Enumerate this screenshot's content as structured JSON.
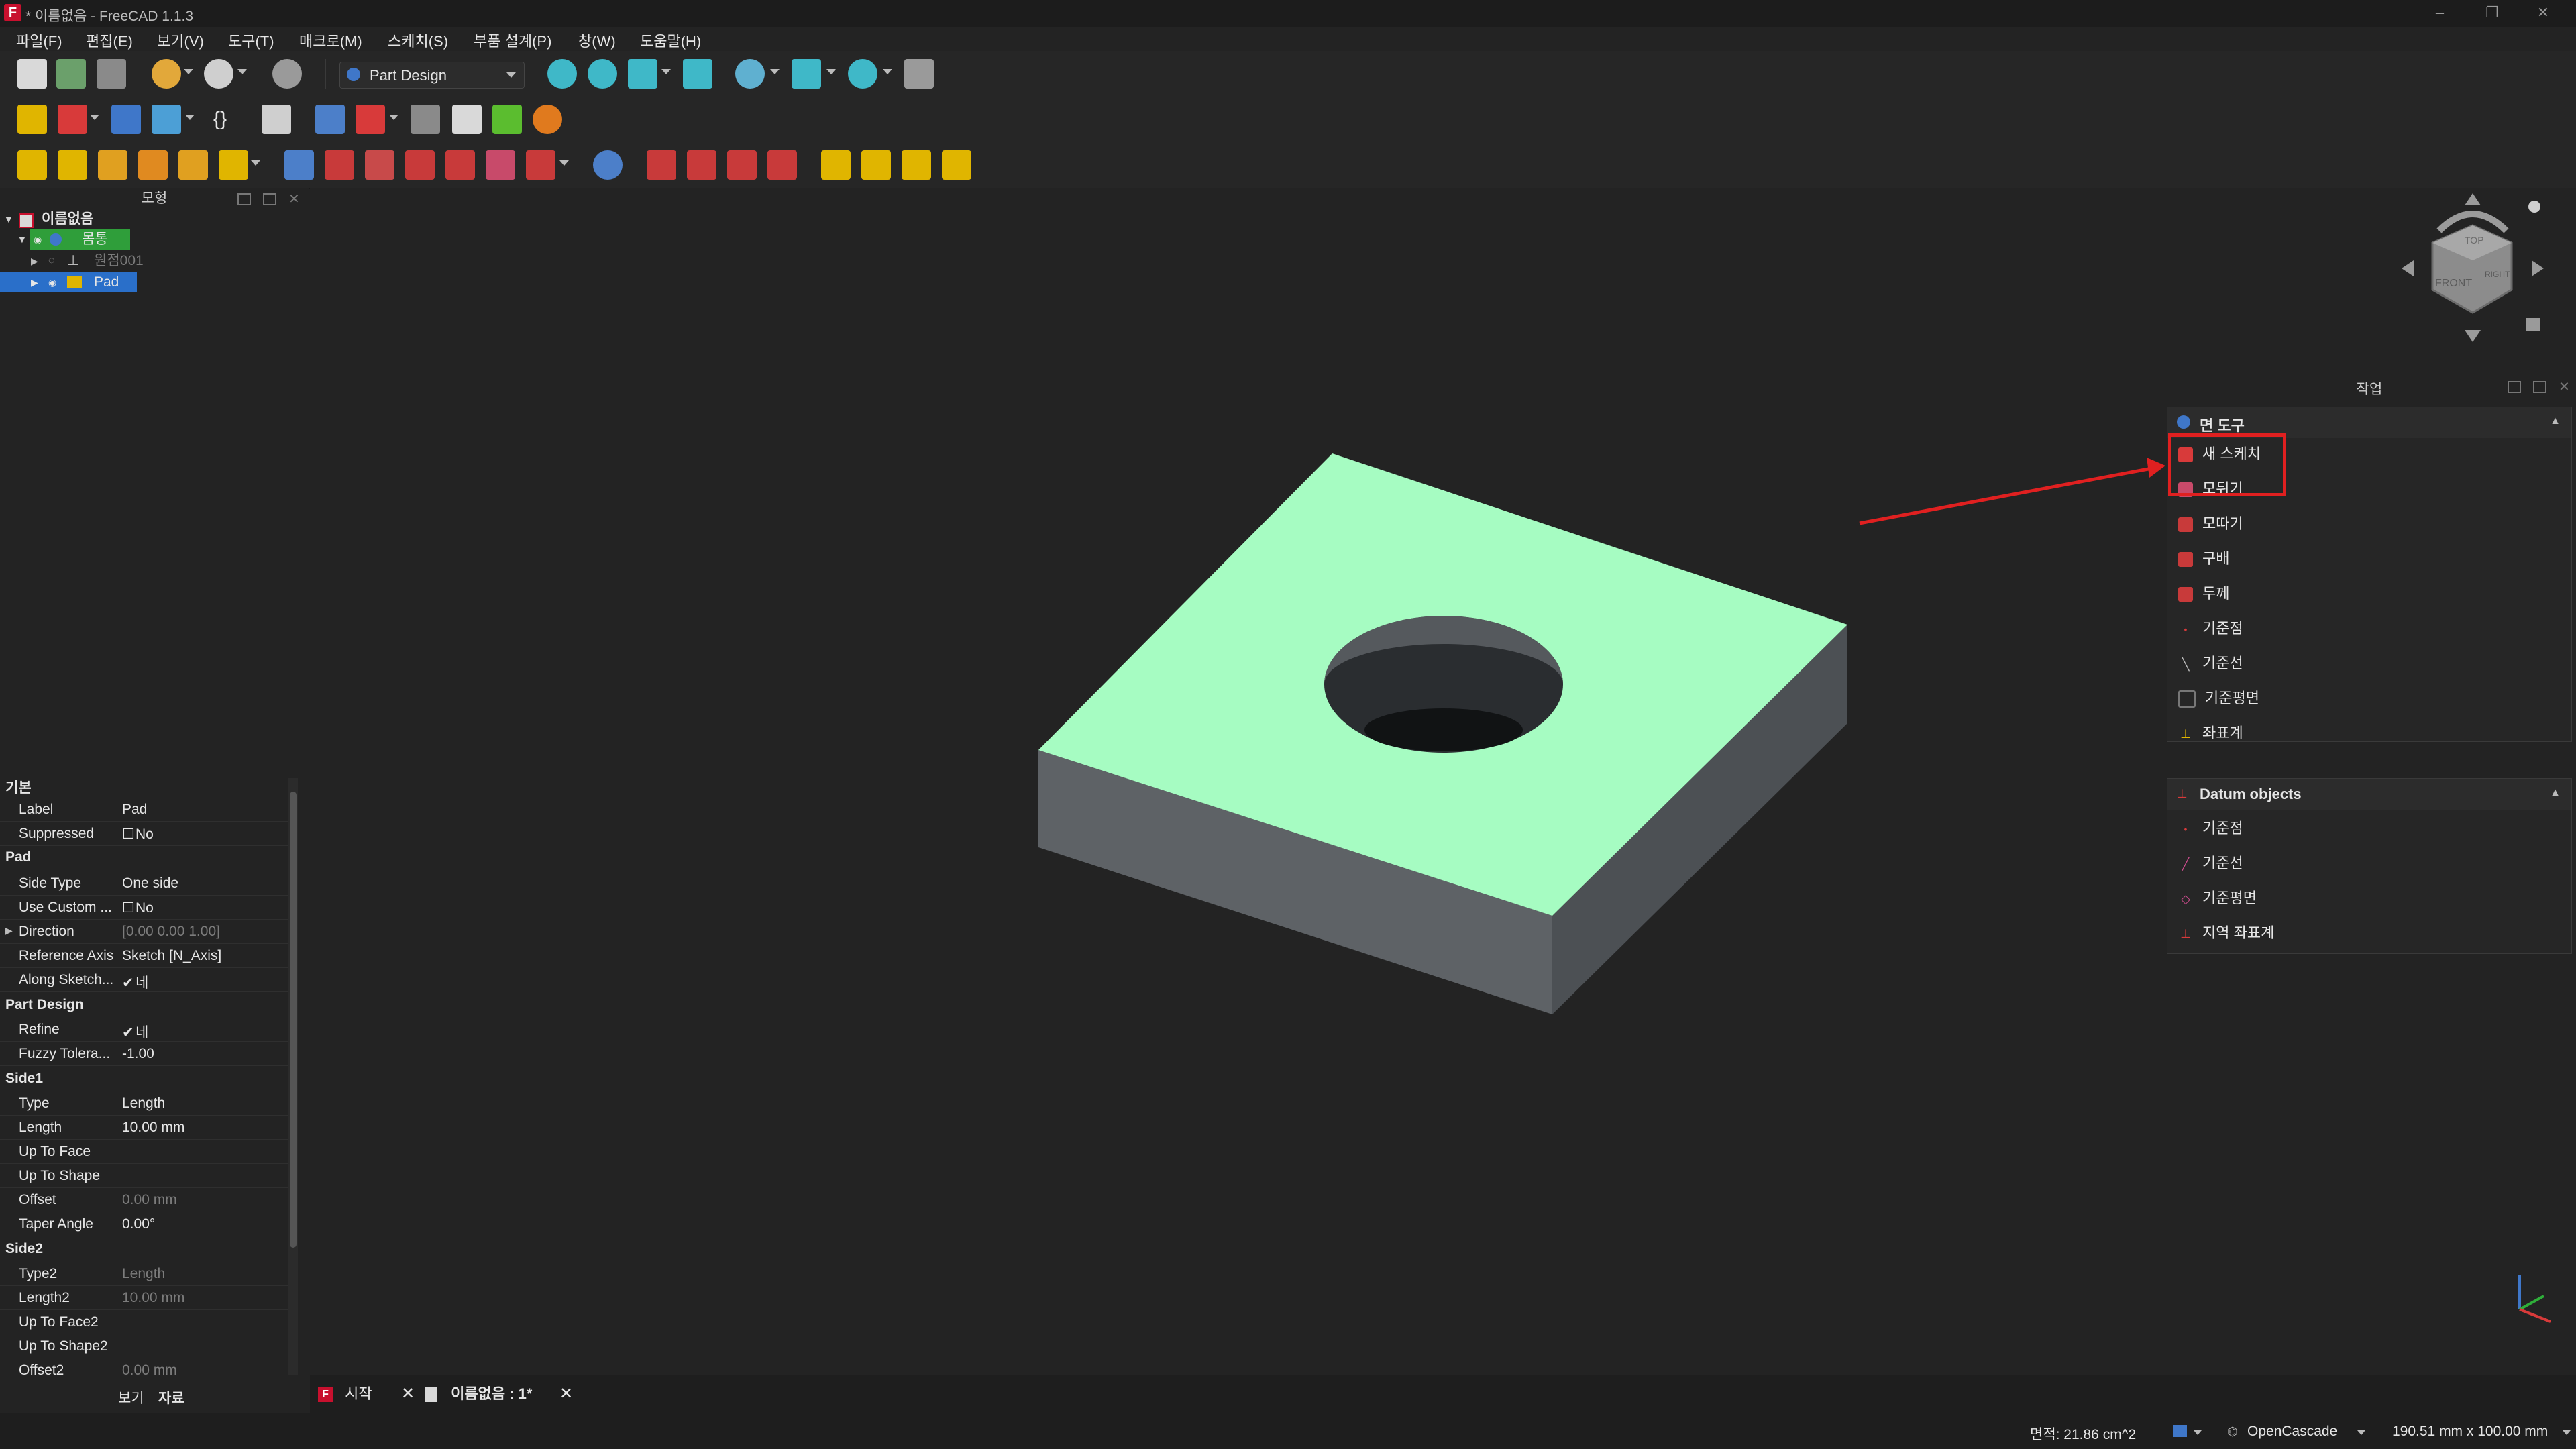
{
  "window": {
    "title": "* 이름없음 - FreeCAD 1.1.3",
    "app_icon_letter": "F"
  },
  "menu": [
    "파일(F)",
    "편집(E)",
    "보기(V)",
    "도구(T)",
    "매크로(M)",
    "스케치(S)",
    "부품 설계(P)",
    "창(W)",
    "도움말(H)"
  ],
  "toolbar": {
    "workbench": "Part Design"
  },
  "tree": {
    "header": "모형",
    "document": "이름없음",
    "body": "몸통",
    "origin": "원점001",
    "pad": "Pad"
  },
  "properties": {
    "groups": {
      "base": "기본",
      "pad": "Pad",
      "part_design": "Part Design",
      "side1": "Side1",
      "side2": "Side2"
    },
    "rows": {
      "label": {
        "name": "Label",
        "value": "Pad"
      },
      "suppressed": {
        "name": "Suppressed",
        "value": "No"
      },
      "side_type": {
        "name": "Side Type",
        "value": "One side"
      },
      "use_custom": {
        "name": "Use Custom ...",
        "value": "No"
      },
      "direction": {
        "name": "Direction",
        "value": "[0.00 0.00 1.00]"
      },
      "reference_axis": {
        "name": "Reference Axis",
        "value": "Sketch [N_Axis]"
      },
      "along_sketch": {
        "name": "Along Sketch...",
        "value": "네"
      },
      "refine": {
        "name": "Refine",
        "value": "네"
      },
      "fuzzy": {
        "name": "Fuzzy Tolera...",
        "value": "-1.00"
      },
      "type": {
        "name": "Type",
        "value": "Length"
      },
      "length": {
        "name": "Length",
        "value": "10.00 mm"
      },
      "up_to_face": {
        "name": "Up To Face",
        "value": ""
      },
      "up_to_shape": {
        "name": "Up To Shape",
        "value": ""
      },
      "offset": {
        "name": "Offset",
        "value": "0.00 mm"
      },
      "taper_angle": {
        "name": "Taper Angle",
        "value": "0.00°"
      },
      "type2": {
        "name": "Type2",
        "value": "Length"
      },
      "length2": {
        "name": "Length2",
        "value": "10.00 mm"
      },
      "up_to_face2": {
        "name": "Up To Face2",
        "value": ""
      },
      "up_to_shape2": {
        "name": "Up To Shape2",
        "value": ""
      },
      "offset2": {
        "name": "Offset2",
        "value": "0.00 mm"
      }
    }
  },
  "left_tabs": {
    "view": "보기",
    "data": "자료"
  },
  "navcube": {
    "top": "TOP",
    "front": "FRONT",
    "right": "RIGHT"
  },
  "task_panel": {
    "header": "작업",
    "face_tools": {
      "title": "면 도구",
      "items": [
        "새 스케치",
        "모뒤기",
        "모따기",
        "구배",
        "두께",
        "기준점",
        "기준선",
        "기준평면",
        "좌표계"
      ]
    },
    "datum_objects": {
      "title": "Datum objects",
      "items": [
        "기준점",
        "기준선",
        "기준평면",
        "지역 좌표계"
      ]
    }
  },
  "doc_tabs": {
    "start": "시작",
    "document": "이름없음 : 1*"
  },
  "status": {
    "area": "면적: 21.86 cm^2",
    "kernel": "OpenCascade",
    "dimensions": "190.51 mm x 100.00 mm"
  },
  "colors": {
    "top_face": "#a6fcc2",
    "side_face": "#5e6266",
    "tree_body_bg": "#2f9e3a",
    "tree_selected_bg": "#2a6fc9",
    "highlight_box": "#e02020",
    "arrow": "#e02020"
  }
}
